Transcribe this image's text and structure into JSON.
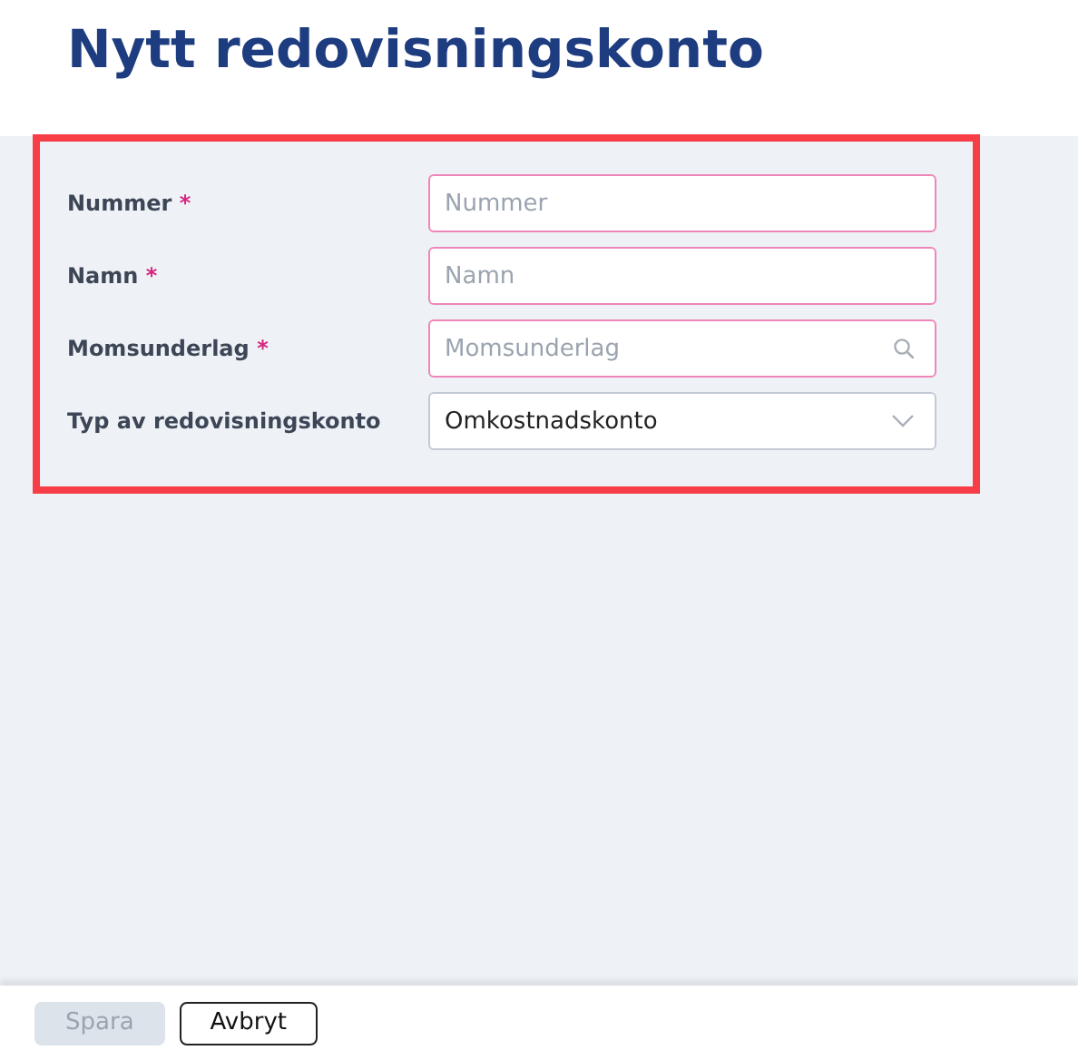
{
  "title": "Nytt redovisningskonto",
  "fields": [
    {
      "label": "Nummer",
      "required_mark": "*",
      "kind": "text",
      "placeholder": "Nummer"
    },
    {
      "label": "Namn",
      "required_mark": "*",
      "kind": "text",
      "placeholder": "Namn"
    },
    {
      "label": "Momsunderlag",
      "required_mark": "*",
      "kind": "search",
      "placeholder": "Momsunderlag"
    },
    {
      "label": "Typ av redovisningskonto",
      "kind": "select",
      "value": "Omkostnadskonto"
    }
  ],
  "buttons": [
    {
      "label": "Spara",
      "disabled": true
    },
    {
      "label": "Avbryt",
      "disabled": false
    }
  ]
}
